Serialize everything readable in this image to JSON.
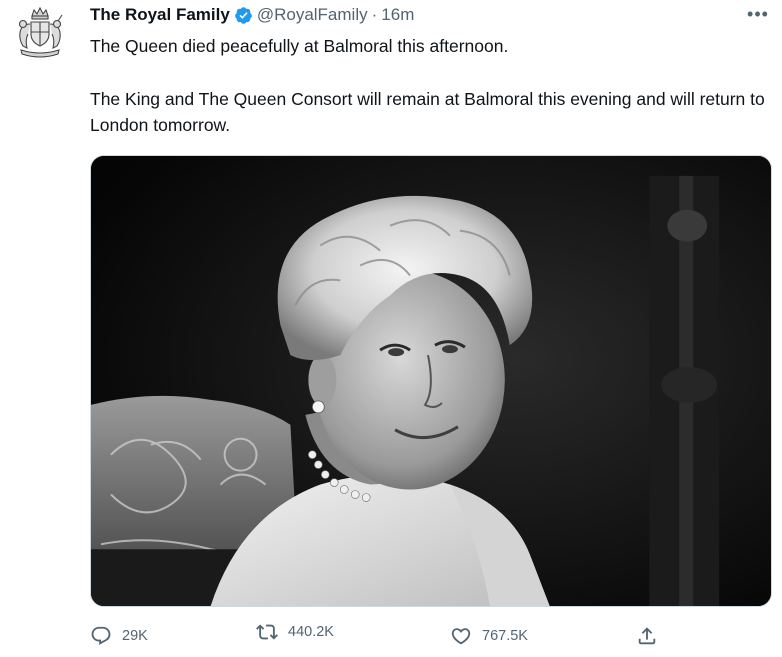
{
  "tweet": {
    "display_name": "The Royal Family",
    "verified_icon": "verified-badge-icon",
    "handle": "@RoyalFamily",
    "separator": "·",
    "time": "16m",
    "more_label": "•••",
    "paragraphs": [
      "The Queen died peacefully at Balmoral this afternoon.",
      "The King and The Queen Consort will remain at Balmoral this evening and will return to London tomorrow."
    ],
    "media": {
      "kind": "photo",
      "description_icon": "black-and-white-portrait-photo"
    },
    "actions": {
      "reply_count": "29K",
      "retweet_count": "440.2K",
      "like_count": "767.5K",
      "share_icon": "share-icon"
    }
  },
  "colors": {
    "text": "#0f1419",
    "muted": "#536471",
    "verified": "#1d9bf0",
    "border": "#cfd9de"
  }
}
